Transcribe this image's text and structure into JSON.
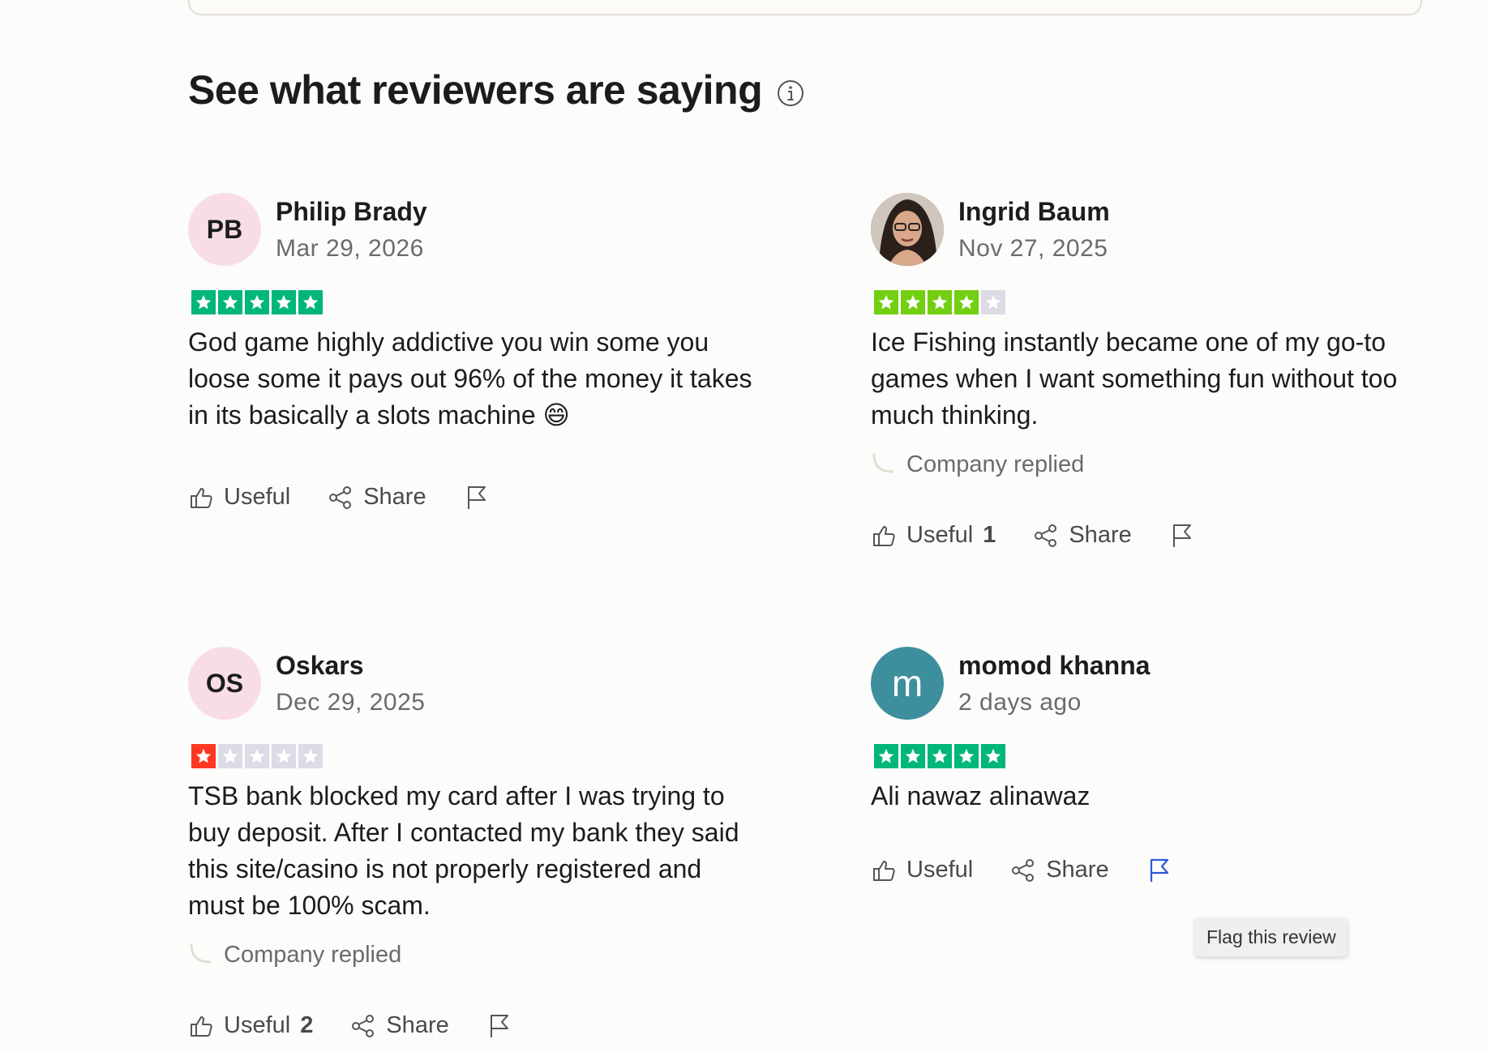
{
  "section": {
    "title": "See what reviewers are saying"
  },
  "colors": {
    "star_green": "#00b67a",
    "star_lightgreen": "#73cf11",
    "star_red": "#ff3722",
    "star_empty": "#dcdce6",
    "flag_active": "#2e57d6"
  },
  "reviews": [
    {
      "initials": "PB",
      "name": "Philip Brady",
      "date": "Mar 29, 2026",
      "rating": 5,
      "text": "God game highly addictive you win some you loose some it pays out 96% of the money it takes in its basically a slots machine 😄",
      "useful_label": "Useful",
      "useful_count": "",
      "share_label": "Share"
    },
    {
      "initials": "",
      "name": "Ingrid Baum",
      "date": "Nov 27, 2025",
      "rating": 4,
      "text": "Ice Fishing instantly became one of my go-to games when I want something fun without too much thinking.",
      "company_replied": "Company replied",
      "useful_label": "Useful",
      "useful_count": "1",
      "share_label": "Share"
    },
    {
      "initials": "OS",
      "name": "Oskars",
      "date": "Dec 29, 2025",
      "rating": 1,
      "text": "TSB bank blocked my card after I was trying to buy deposit. After I contacted my bank they said this site/casino is not properly registered and must be 100% scam.",
      "company_replied": "Company replied",
      "useful_label": "Useful",
      "useful_count": "2",
      "share_label": "Share"
    },
    {
      "initials": "m",
      "name": "momod khanna",
      "date": "2 days ago",
      "rating": 5,
      "text": "Ali nawaz alinawaz",
      "useful_label": "Useful",
      "useful_count": "",
      "share_label": "Share"
    }
  ],
  "tooltip": {
    "flag": "Flag this review"
  }
}
